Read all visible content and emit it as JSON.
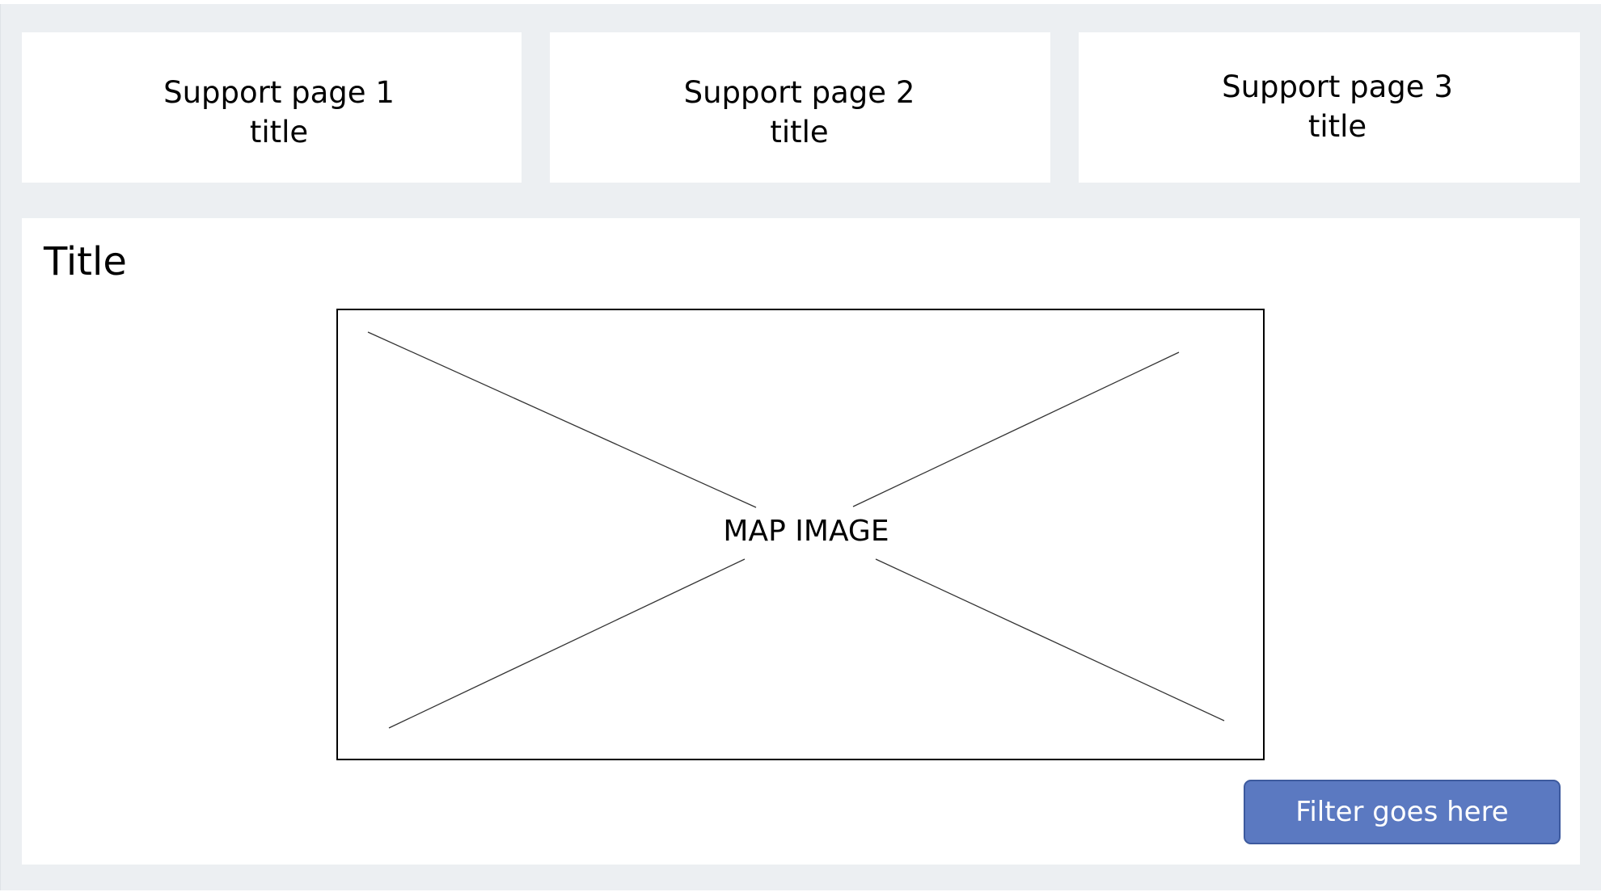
{
  "support_pages": [
    {
      "title": "Support  page 1\ntitle"
    },
    {
      "title": "Support  page 2\ntitle"
    },
    {
      "title": "Support  page 3\ntitle"
    }
  ],
  "main": {
    "title": "Title",
    "map_placeholder": "MAP IMAGE",
    "filter_label": "Filter goes here"
  },
  "colors": {
    "background": "#eceff2",
    "card": "#ffffff",
    "filter_button": "#5b79c1",
    "filter_button_border": "#3d5a9e"
  },
  "icons": {
    "map_placeholder": "image-placeholder-icon"
  }
}
